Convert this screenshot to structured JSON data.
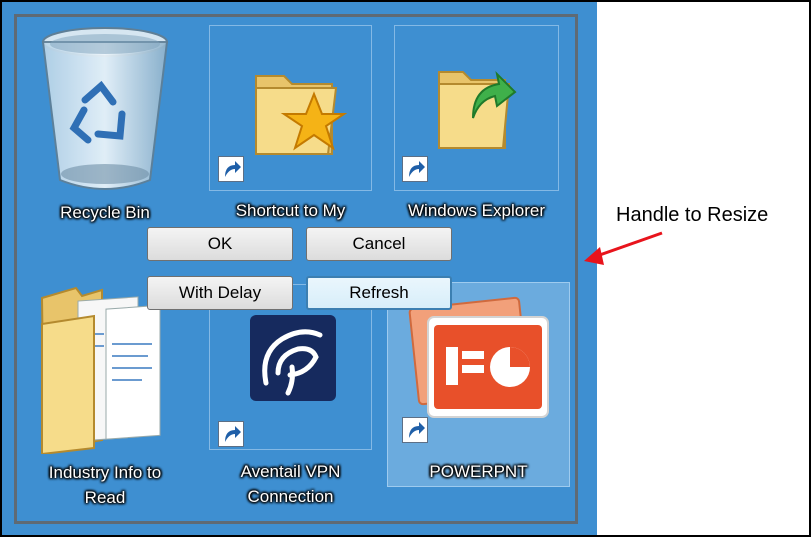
{
  "desktop": {
    "icons": [
      {
        "label": "Recycle Bin",
        "icon": "recycle-bin-icon"
      },
      {
        "label": "Shortcut to My",
        "icon": "favorites-folder-icon",
        "shortcut": true
      },
      {
        "label": "Windows Explorer",
        "icon": "explorer-folder-icon",
        "shortcut": true
      },
      {
        "label": "Industry Info to",
        "label2": "Read",
        "icon": "documents-folder-icon"
      },
      {
        "label": "Aventail VPN",
        "label2": "Connection",
        "icon": "aventail-vpn-icon",
        "shortcut": true
      },
      {
        "label": "POWERPNT",
        "icon": "powerpoint-icon",
        "shortcut": true
      }
    ],
    "buttons": {
      "ok": "OK",
      "cancel": "Cancel",
      "with_delay": "With Delay",
      "refresh": "Refresh"
    }
  },
  "annotation": {
    "text": "Handle to Resize",
    "arrow_color": "#e8141c"
  },
  "colors": {
    "desktop_bg": "#3e8fd1",
    "border": "#5f6a74"
  }
}
